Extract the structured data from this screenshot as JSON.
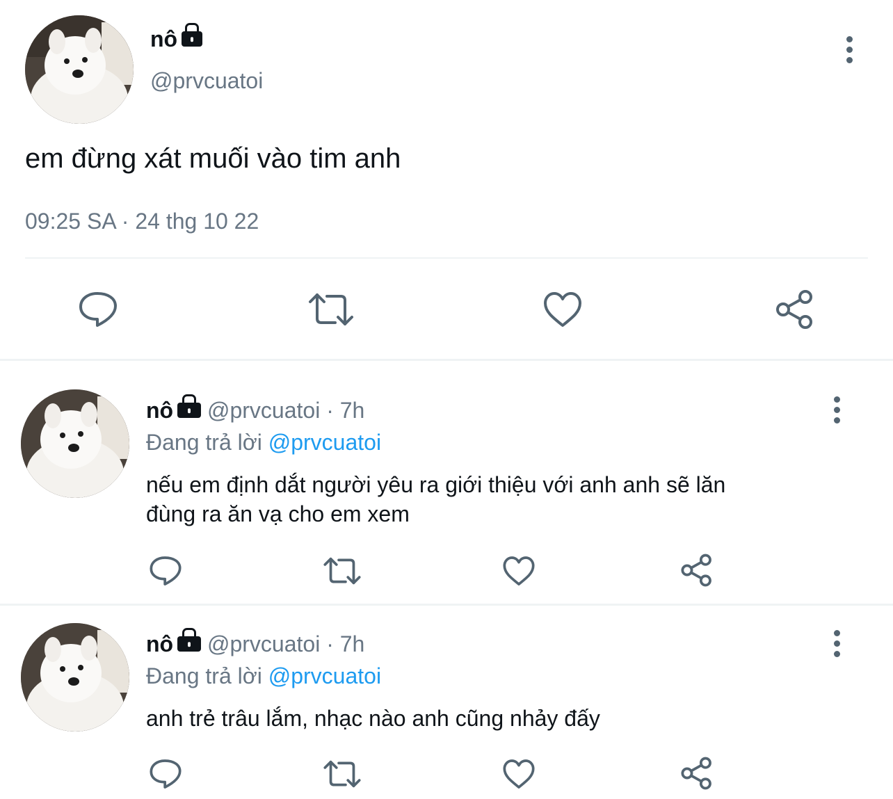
{
  "main_tweet": {
    "display_name": "nô",
    "handle": "@prvcuatoi",
    "text": "em đừng xát muối vào tim anh",
    "timestamp": "09:25 SA · 24 thg 10 22",
    "lock_icon": "lock-icon",
    "actions": [
      "reply-icon",
      "retweet-icon",
      "like-icon",
      "share-icon"
    ]
  },
  "replies": [
    {
      "display_name": "nô",
      "handle": "@prvcuatoi",
      "time": "· 7h",
      "replying_label": "Đang trả lời",
      "replying_to": "@prvcuatoi",
      "text_line1": "nếu em định dắt người yêu ra giới thiệu với anh anh sẽ lăn",
      "text_line2": "đùng ra ăn vạ cho em xem"
    },
    {
      "display_name": "nô",
      "handle": "@prvcuatoi",
      "time": "· 7h",
      "replying_label": "Đang trả lời",
      "replying_to": "@prvcuatoi",
      "text_line1": "anh trẻ trâu lắm, nhạc nào anh cũng nhảy đấy",
      "text_line2": ""
    }
  ],
  "colors": {
    "text": "#0f1419",
    "secondary": "#687684",
    "link": "#1d9bf0",
    "divider": "#eff3f4",
    "icon": "#536471"
  }
}
